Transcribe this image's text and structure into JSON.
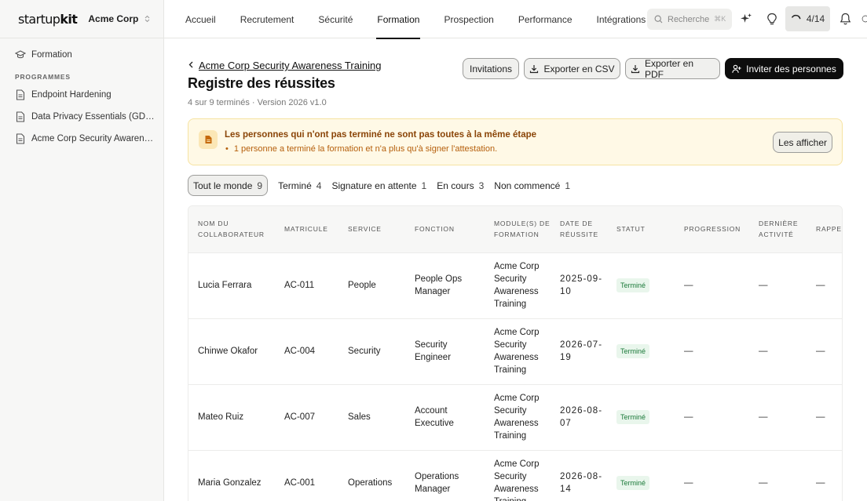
{
  "brand": {
    "logo_light": "startup",
    "logo_bold": "kit",
    "org_name": "Acme Corp"
  },
  "sidebar": {
    "top_item": "Formation",
    "section_label": "PROGRAMMES",
    "programs": [
      "Endpoint Hardening",
      "Data Privacy Essentials (GDPR)",
      "Acme Corp Security Awareness Training"
    ]
  },
  "topnav": {
    "tabs": [
      "Accueil",
      "Recrutement",
      "Sécurité",
      "Formation",
      "Prospection",
      "Performance",
      "Intégrations"
    ],
    "active_tab": "Formation",
    "search_placeholder": "Recherche",
    "search_shortcut": "⌘K",
    "progress": "4/14"
  },
  "page": {
    "breadcrumb": "Acme Corp Security Awareness Training",
    "title": "Registre des réussites",
    "subtitle": "4 sur 9 terminés · Version 2026 v1.0",
    "buttons": {
      "invitations": "Invitations",
      "export_csv": "Exporter en CSV",
      "export_pdf": "Exporter en PDF",
      "invite": "Inviter des personnes"
    }
  },
  "notice": {
    "title": "Les personnes qui n'ont pas terminé ne sont pas toutes à la même étape",
    "item": "1 personne a terminé la formation et n'a plus qu'à signer l'attestation.",
    "button": "Les afficher"
  },
  "filters": [
    {
      "label": "Tout le monde",
      "count": "9"
    },
    {
      "label": "Terminé",
      "count": "4"
    },
    {
      "label": "Signature en attente",
      "count": "1"
    },
    {
      "label": "En cours",
      "count": "3"
    },
    {
      "label": "Non commencé",
      "count": "1"
    }
  ],
  "table": {
    "headers": [
      "Nom du collaborateur",
      "Matricule",
      "Service",
      "Fonction",
      "Module(s) de formation",
      "Date de réussite",
      "Statut",
      "Progression",
      "Dernière activité",
      "Rappel"
    ],
    "rows": [
      {
        "name": "Lucia Ferrara",
        "id": "AC-011",
        "service": "People",
        "role": "People Ops Manager",
        "module": "Acme Corp Security Awareness Training",
        "date": "2025-09-10",
        "status": "Terminé",
        "progress": "—",
        "last": "—",
        "reminder": "—"
      },
      {
        "name": "Chinwe Okafor",
        "id": "AC-004",
        "service": "Security",
        "role": "Security Engineer",
        "module": "Acme Corp Security Awareness Training",
        "date": "2026-07-19",
        "status": "Terminé",
        "progress": "—",
        "last": "—",
        "reminder": "—"
      },
      {
        "name": "Mateo Ruiz",
        "id": "AC-007",
        "service": "Sales",
        "role": "Account Executive",
        "module": "Acme Corp Security Awareness Training",
        "date": "2026-08-07",
        "status": "Terminé",
        "progress": "—",
        "last": "—",
        "reminder": "—"
      },
      {
        "name": "Maria Gonzalez",
        "id": "AC-001",
        "service": "Operations",
        "role": "Operations Manager",
        "module": "Acme Corp Security Awareness Training",
        "date": "2026-08-14",
        "status": "Terminé",
        "progress": "—",
        "last": "—",
        "reminder": "—"
      }
    ]
  },
  "colors": {
    "status_green": "#1c7a3a",
    "notice_bg": "#fff9e6",
    "notice_text": "#8a4508",
    "primary_dark": "#0d0d0d"
  }
}
